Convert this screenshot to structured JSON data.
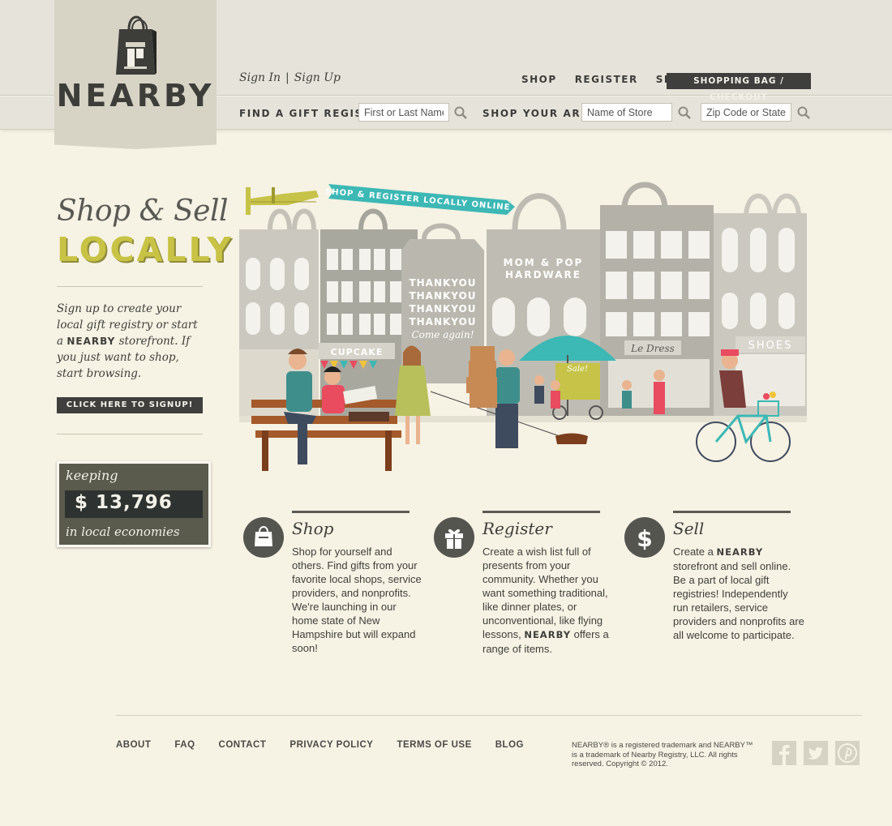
{
  "brand": {
    "name": "NEARBY"
  },
  "header": {
    "sign_in": "Sign In",
    "separator": "|",
    "sign_up": "Sign Up",
    "nav": [
      "SHOP",
      "REGISTER",
      "SELL"
    ],
    "bag_button": "SHOPPING BAG / CHECKOUT",
    "registry_label": "FIND A GIFT REGISTRY",
    "registry_placeholder": "First or Last Name",
    "area_label": "SHOP YOUR AREA",
    "store_placeholder": "Name of Store",
    "zip_placeholder": "Zip Code or State"
  },
  "hero_side": {
    "headline_1": "Shop & Sell",
    "headline_2": "LOCALLY",
    "intro_a": "Sign up to create your local gift registry or start a",
    "intro_brand": "NEARBY",
    "intro_b": "storefront. If you just want to shop, start browsing.",
    "signup_button": "CLICK HERE TO SIGNUP!",
    "counter_top": "keeping",
    "counter_amount": "$ 13,796",
    "counter_bottom": "in local economies"
  },
  "illustration": {
    "banner": "SHOP & REGISTER LOCALLY ONLINE",
    "hardware_1": "MOM & POP",
    "hardware_2": "HARDWARE",
    "thanks_line": "THANKYOU",
    "come_again": "Come again!",
    "cupcake": "CUPCAKE",
    "dress": "Le Dress",
    "shoes": "SHOES",
    "sale": "Sale!"
  },
  "features": [
    {
      "title": "Shop",
      "desc": "Shop for yourself and others. Find gifts from your favorite local shops, service providers, and nonprofits. We're launching in our home state of New Hampshire but will expand soon!",
      "icon": "shopping-bag-icon"
    },
    {
      "title": "Register",
      "desc_a": "Create a wish list full of presents from your community. Whether you want something traditional, like dinner plates, or unconventional, like flying lessons,",
      "brand": "NEARBY",
      "desc_b": "offers a range of items.",
      "icon": "gift-icon"
    },
    {
      "title": "Sell",
      "desc_a": "Create a",
      "brand": "NEARBY",
      "desc_b": "storefront and sell online. Be a part of local gift registries! Independently run retailers, service providers and nonprofits are all welcome to participate.",
      "icon": "dollar-icon"
    }
  ],
  "footer": {
    "nav": [
      "ABOUT",
      "FAQ",
      "CONTACT",
      "PRIVACY POLICY",
      "TERMS OF USE",
      "BLOG"
    ],
    "legal": "NEARBY® is a registered trademark and NEARBY™ is a trademark of Nearby Registry, LLC. All rights reserved. Copyright © 2012.",
    "social": [
      "facebook-icon",
      "twitter-icon",
      "pinterest-icon"
    ]
  },
  "colors": {
    "accent_yellow": "#c8c345",
    "teal": "#3cb8b5",
    "dark": "#3f3f3d",
    "background": "#f6f2e4",
    "header": "#e6e4da"
  }
}
